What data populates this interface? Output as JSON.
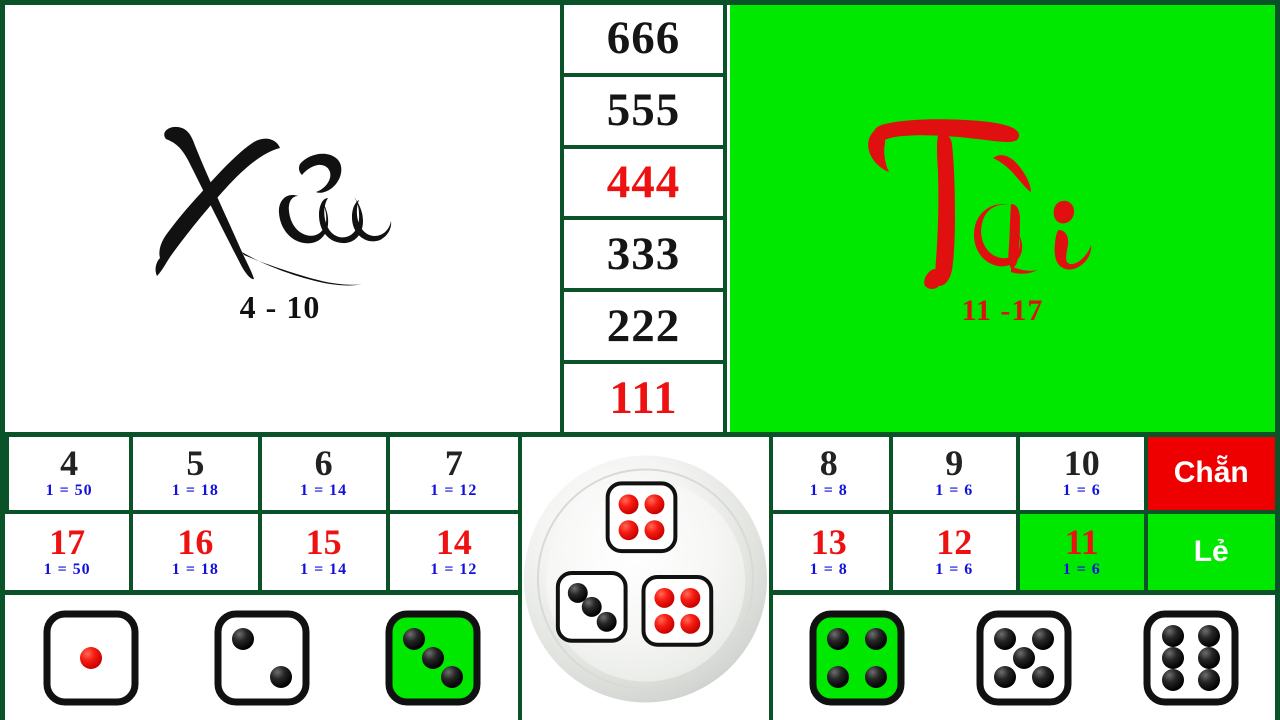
{
  "game": {
    "title": "Tai Xiu",
    "border_color": "#0a5228",
    "green": "#00e800",
    "red": "#ee1111",
    "blue": "#1111dd"
  },
  "xiu_panel": {
    "label": "Xỉu",
    "range": "4 - 10",
    "text_color": "#111111",
    "background": "#ffffff"
  },
  "tai_panel": {
    "label": "Tài",
    "range": "11 -17",
    "text_color": "#e01010",
    "background": "#00e800"
  },
  "triples": [
    {
      "label": "666",
      "color": "black"
    },
    {
      "label": "555",
      "color": "black"
    },
    {
      "label": "444",
      "color": "red"
    },
    {
      "label": "333",
      "color": "black"
    },
    {
      "label": "222",
      "color": "black"
    },
    {
      "label": "111",
      "color": "red"
    }
  ],
  "bets_left": [
    {
      "number": "4",
      "odds": "1 = 50",
      "color": "black",
      "selected": false
    },
    {
      "number": "5",
      "odds": "1 = 18",
      "color": "black",
      "selected": false
    },
    {
      "number": "6",
      "odds": "1 = 14",
      "color": "black",
      "selected": false
    },
    {
      "number": "7",
      "odds": "1 = 12",
      "color": "black",
      "selected": false
    },
    {
      "number": "17",
      "odds": "1 = 50",
      "color": "red",
      "selected": false
    },
    {
      "number": "16",
      "odds": "1 = 18",
      "color": "red",
      "selected": false
    },
    {
      "number": "15",
      "odds": "1 = 14",
      "color": "red",
      "selected": false
    },
    {
      "number": "14",
      "odds": "1 = 12",
      "color": "red",
      "selected": false
    }
  ],
  "bets_right": [
    {
      "number": "8",
      "odds": "1 = 8",
      "color": "black",
      "selected": false
    },
    {
      "number": "9",
      "odds": "1 = 6",
      "color": "black",
      "selected": false
    },
    {
      "number": "10",
      "odds": "1 = 6",
      "color": "black",
      "selected": false
    },
    {
      "number": "13",
      "odds": "1 = 8",
      "color": "red",
      "selected": false
    },
    {
      "number": "12",
      "odds": "1 = 6",
      "color": "red",
      "selected": false
    },
    {
      "number": "11",
      "odds": "1 = 6",
      "color": "red",
      "selected": true
    }
  ],
  "parity": {
    "even_label": "Chẵn",
    "even_bg": "#ee0000",
    "odd_label": "Lẻ",
    "odd_bg": "#00e800"
  },
  "bowl": {
    "dice": [
      {
        "value": 4,
        "pip_color": "red",
        "position": "top"
      },
      {
        "value": 3,
        "pip_color": "black",
        "position": "bottom-left"
      },
      {
        "value": 4,
        "pip_color": "red",
        "position": "bottom-right"
      }
    ],
    "total": 11
  },
  "dice_buttons_left": [
    {
      "value": 1,
      "pip_color": "red",
      "selected": false
    },
    {
      "value": 2,
      "pip_color": "black",
      "selected": false
    },
    {
      "value": 3,
      "pip_color": "black",
      "selected": true
    }
  ],
  "dice_buttons_right": [
    {
      "value": 4,
      "pip_color": "black",
      "selected": true
    },
    {
      "value": 5,
      "pip_color": "black",
      "selected": false
    },
    {
      "value": 6,
      "pip_color": "black",
      "selected": false
    }
  ]
}
